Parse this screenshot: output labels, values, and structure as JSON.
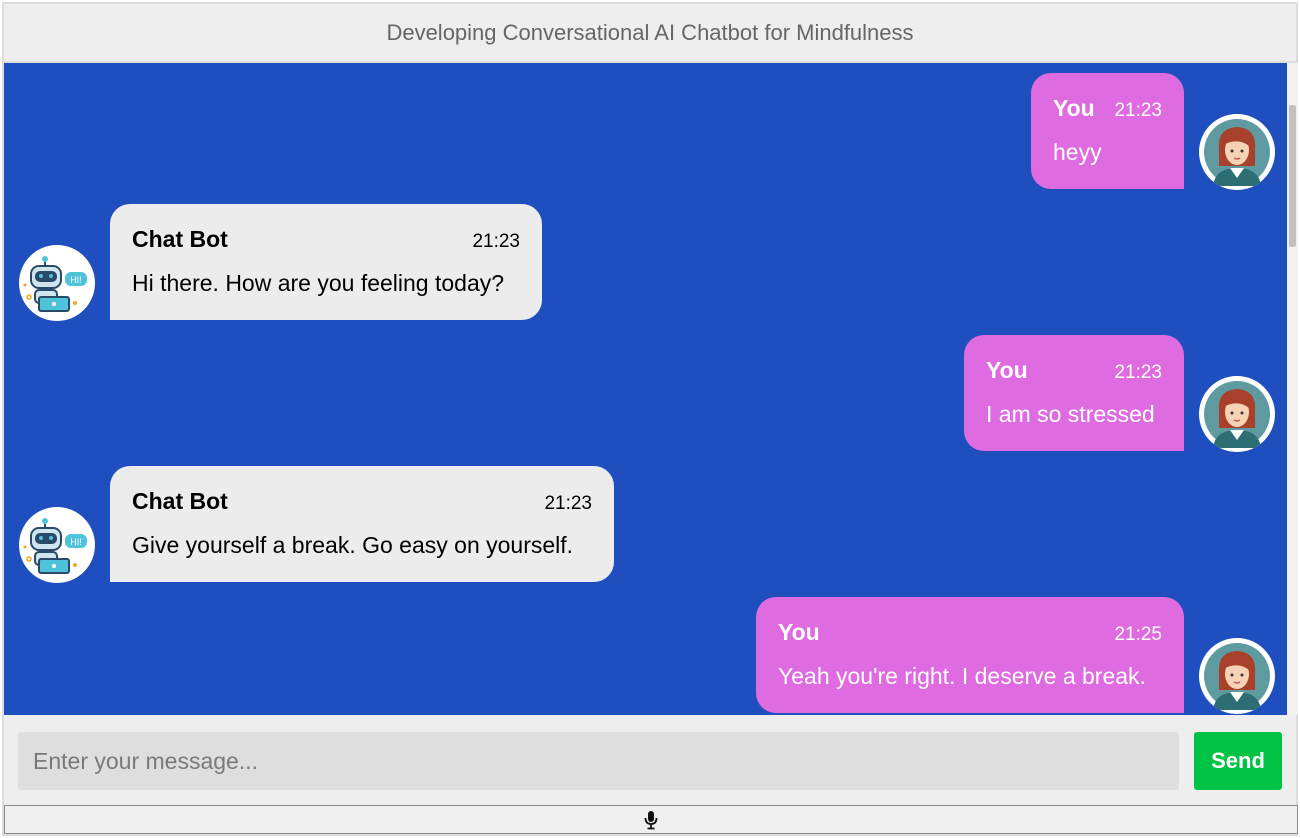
{
  "header": {
    "title": "Developing Conversational AI Chatbot for Mindfulness"
  },
  "messages": [
    {
      "role": "user",
      "sender": "You",
      "time": "21:23",
      "text": "heyy"
    },
    {
      "role": "bot",
      "sender": "Chat Bot",
      "time": "21:23",
      "text": "Hi there. How are you feeling today?"
    },
    {
      "role": "user",
      "sender": "You",
      "time": "21:23",
      "text": "I am so stressed"
    },
    {
      "role": "bot",
      "sender": "Chat Bot",
      "time": "21:23",
      "text": "Give yourself a break. Go easy on yourself."
    },
    {
      "role": "user",
      "sender": "You",
      "time": "21:25",
      "text": "Yeah you're right. I deserve a break."
    }
  ],
  "composer": {
    "placeholder": "Enter your message...",
    "value": "",
    "send_label": "Send"
  },
  "icons": {
    "mic": "microphone-icon",
    "user_avatar": "woman-avatar-icon",
    "bot_avatar": "robot-avatar-icon"
  },
  "colors": {
    "chat_bg": "#1f4fbf",
    "user_bubble": "#df6be0",
    "bot_bubble": "#ececec",
    "send_button": "#00c346"
  }
}
